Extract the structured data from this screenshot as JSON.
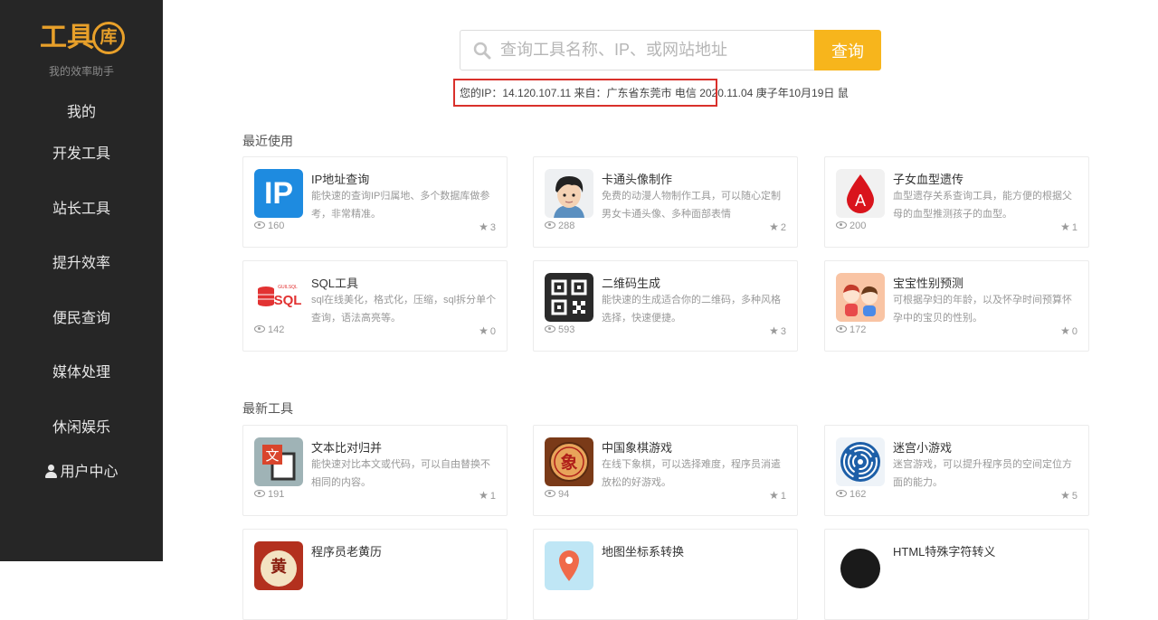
{
  "brand": {
    "logo_text": "工具",
    "logo_badge": "库",
    "slogan": "我的效率助手"
  },
  "nav": [
    {
      "label": "我的"
    },
    {
      "label": "开发工具"
    },
    {
      "label": "站长工具"
    },
    {
      "label": "提升效率"
    },
    {
      "label": "便民查询"
    },
    {
      "label": "媒体处理"
    },
    {
      "label": "休闲娱乐"
    },
    {
      "label": "用户中心"
    }
  ],
  "search": {
    "placeholder": "查询工具名称、IP、或网站地址",
    "button_label": "查询"
  },
  "ip_info": "您的IP：14.120.107.11 来自：广东省东莞市 电信 2020.11.04 庚子年10月19日 鼠",
  "recent": {
    "title": "最近使用",
    "cards": [
      {
        "name": "IP地址查询",
        "desc": "能快速的查询IP归属地、多个数据库做参考，非常精准。",
        "views": "160",
        "stars": "3",
        "icon": "ip-icon"
      },
      {
        "name": "卡通头像制作",
        "desc": "免费的动漫人物制作工具，可以随心定制男女卡通头像、多种面部表情",
        "views": "288",
        "stars": "2",
        "icon": "cartoon-avatar-icon"
      },
      {
        "name": "子女血型遗传",
        "desc": "血型遗存关系查询工具，能方便的根据父母的血型推测孩子的血型。",
        "views": "200",
        "stars": "1",
        "icon": "blood-drop-icon"
      },
      {
        "name": "SQL工具",
        "desc": "sql在线美化，格式化，压缩，sql拆分单个查询，语法高亮等。",
        "views": "142",
        "stars": "0",
        "icon": "sql-icon"
      },
      {
        "name": "二维码生成",
        "desc": "能快速的生成适合你的二维码，多种风格选择，快速便捷。",
        "views": "593",
        "stars": "3",
        "icon": "qr-code-icon"
      },
      {
        "name": "宝宝性别预测",
        "desc": "可根据孕妇的年龄，以及怀孕时间预算怀孕中的宝贝的性别。",
        "views": "172",
        "stars": "0",
        "icon": "baby-icon"
      }
    ]
  },
  "newest": {
    "title": "最新工具",
    "cards": [
      {
        "name": "文本比对归并",
        "desc": "能快速对比本文或代码，可以自由替换不相同的内容。",
        "views": "191",
        "stars": "1",
        "icon": "text-compare-icon",
        "badge": "文"
      },
      {
        "name": "中国象棋游戏",
        "desc": "在线下象棋，可以选择难度，程序员消遣放松的好游戏。",
        "views": "94",
        "stars": "1",
        "icon": "chinese-chess-icon",
        "badge": "象"
      },
      {
        "name": "迷宫小游戏",
        "desc": "迷宫游戏，可以提升程序员的空间定位方面的能力。",
        "views": "162",
        "stars": "5",
        "icon": "maze-icon"
      },
      {
        "name": "程序员老黄历",
        "desc": "",
        "views": "",
        "stars": "",
        "icon": "almanac-icon",
        "badge": "黄"
      },
      {
        "name": "地图坐标系转换",
        "desc": "",
        "views": "",
        "stars": "",
        "icon": "map-pin-icon"
      },
      {
        "name": "HTML特殊字符转义",
        "desc": "",
        "views": "",
        "stars": "",
        "icon": "html-escape-icon"
      }
    ]
  },
  "icons": {
    "ip_text": "IP",
    "sql_text": "SQL",
    "sql_sub": "GUILSQL"
  },
  "colors": {
    "accent": "#f7b51c",
    "sidebar": "#262626",
    "brand": "#e8a02a",
    "highlight": "#d9302b"
  }
}
